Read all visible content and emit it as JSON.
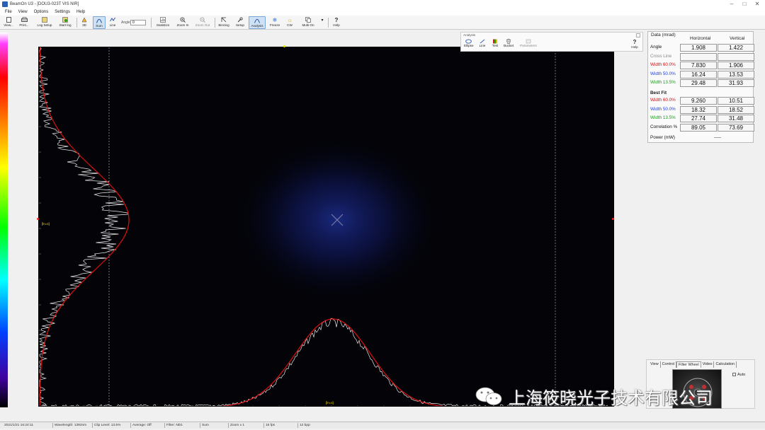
{
  "window": {
    "title": "BeamOn U3 - [DOU3-023T VIS NIR]"
  },
  "menu": [
    "File",
    "View",
    "Options",
    "Settings",
    "Help"
  ],
  "toolbar": {
    "view": "View...",
    "print": "Print...",
    "log_setup": "Log Setup",
    "start_log": "Start log",
    "threed": "3D",
    "sum": "Sum",
    "line": "Line",
    "angle_label": "Angle",
    "angle_value": "0",
    "statistics": "Statistics",
    "zoom_in": "Zoom In",
    "zoom_out": "Zoom Out",
    "binning": "Binning",
    "setup": "Setup",
    "analysis": "Analysis",
    "freeze": "Freeze",
    "cw": "CW",
    "multi_on": "Multi On",
    "help": "Help"
  },
  "analysis_panel": {
    "title": "Analysis",
    "buttons": [
      "Ellipse",
      "Line",
      "Test",
      "Bucket",
      "Parameters"
    ],
    "help": "Help"
  },
  "plot": {
    "vertical_label": "[ln=s]",
    "horizontal_label": "[ln=s]"
  },
  "data_table": {
    "header": "Data (mrad)",
    "col_h": "Horizontal",
    "col_v": "Vertical",
    "rows": [
      {
        "label": "Angle",
        "h": "1.908",
        "v": "1.422",
        "color": "#111111"
      },
      {
        "label": "Cross Line",
        "h": "",
        "v": "",
        "color": "#888888"
      },
      {
        "label": "Width 60.0%",
        "h": "7.830",
        "v": "1.906",
        "color": "#d01010"
      },
      {
        "label": "Width 50.0%",
        "h": "16.24",
        "v": "13.53",
        "color": "#2040e0"
      },
      {
        "label": "Width 13.5%",
        "h": "29.48",
        "v": "31.93",
        "color": "#10a010"
      }
    ],
    "best_fit_label": "Best Fit",
    "fit_rows": [
      {
        "label": "Width 60.0%",
        "h": "9.260",
        "v": "10.51",
        "color": "#d01010"
      },
      {
        "label": "Width 50.0%",
        "h": "18.32",
        "v": "18.52",
        "color": "#2040e0"
      },
      {
        "label": "Width 13.5%",
        "h": "27.74",
        "v": "31.48",
        "color": "#10a010"
      },
      {
        "label": "Correlation %",
        "h": "89.05",
        "v": "73.69",
        "color": "#111111"
      }
    ],
    "power_label": "Power (mW)",
    "power_value": "-----"
  },
  "bottom_panel": {
    "tabs": [
      "View",
      "Control",
      "Filter Wheel",
      "Video",
      "Calculation"
    ],
    "selected_tab": "Filter Wheel",
    "auto_label": "Auto"
  },
  "statusbar": [
    "2021/1/21 16:24:11",
    "Wavelength: 1392nm",
    "Clip Level: 13.5%",
    "Average: Off",
    "Filter: ND1",
    "Sum",
    "Zoom x 1",
    "16 fps",
    "12 bpp"
  ],
  "watermark": {
    "text": "上海筱晓光子技术有限公司"
  },
  "colors": {
    "fit_curve": "#e01010",
    "profile": "#e8e8e8",
    "crosshair": "#8888aa",
    "beam_glow": "#1a2a7a"
  }
}
